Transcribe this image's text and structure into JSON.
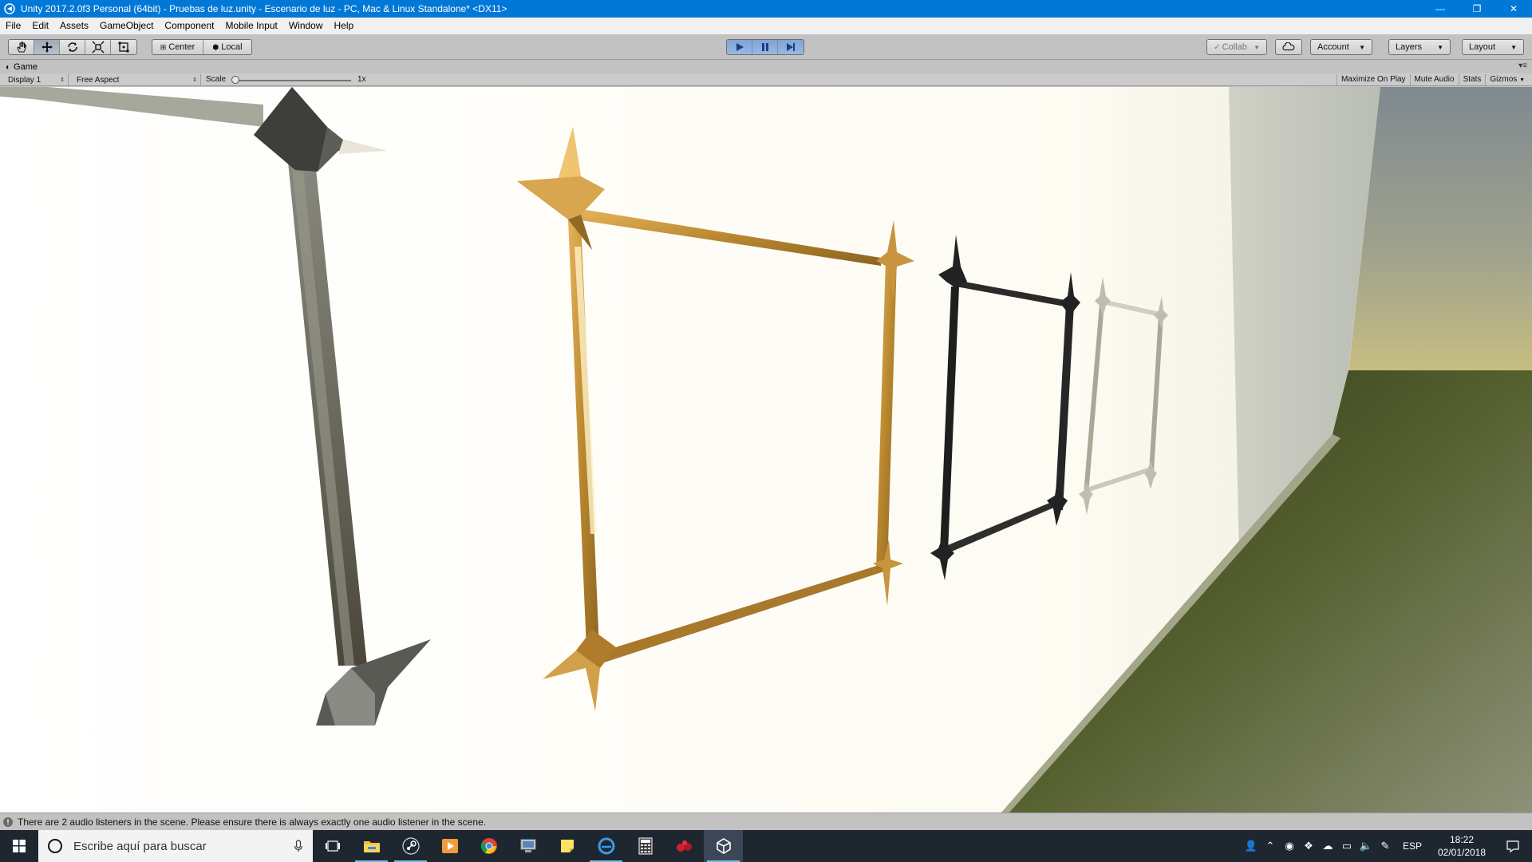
{
  "window": {
    "title": "Unity 2017.2.0f3 Personal (64bit) - Pruebas de luz.unity - Escenario de luz - PC, Mac & Linux Standalone* <DX11>",
    "minimize": "—",
    "maximize": "❐",
    "close": "✕"
  },
  "menu": [
    "File",
    "Edit",
    "Assets",
    "GameObject",
    "Component",
    "Mobile Input",
    "Window",
    "Help"
  ],
  "toolbar": {
    "pivot_label": "Center",
    "space_label": "Local",
    "collab_label": "Collab",
    "account_label": "Account",
    "layers_label": "Layers",
    "layout_label": "Layout"
  },
  "game_view": {
    "tab_label": "Game",
    "display_label": "Display 1",
    "aspect_label": "Free Aspect",
    "scale_label": "Scale",
    "scale_value": "1x",
    "maximize_on_play": "Maximize On Play",
    "mute_audio": "Mute Audio",
    "stats": "Stats",
    "gizmos": "Gizmos"
  },
  "status": {
    "message": "There are 2 audio listeners in the scene. Please ensure there is always exactly one audio listener in the scene."
  },
  "taskbar": {
    "search_placeholder": "Escribe aquí para buscar",
    "language": "ESP",
    "time": "18:22",
    "date": "02/01/2018"
  },
  "colors": {
    "titlebar": "#0078d7",
    "toolbar": "#c2c2c2",
    "taskbar": "#1e2630",
    "play_active": "#7fa4d6",
    "gold_frame": "#c8963c",
    "dark_frame": "#2a2a2a",
    "silver_frame": "#bdbdb0"
  }
}
